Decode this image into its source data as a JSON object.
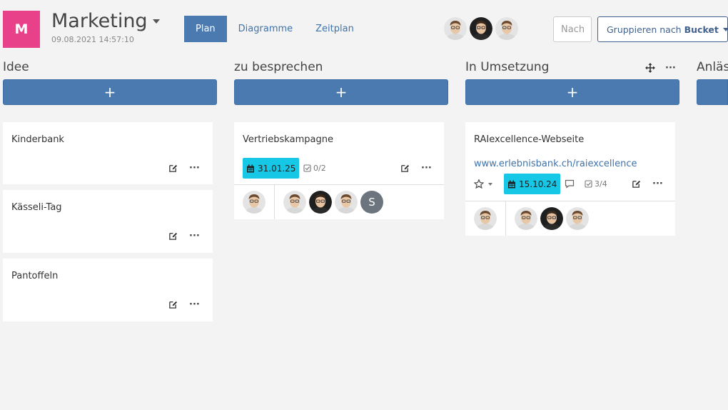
{
  "header": {
    "logo_letter": "M",
    "title": "Marketing",
    "subtitle": "09.08.2021 14:57:10",
    "tabs": [
      {
        "label": "Plan"
      },
      {
        "label": "Diagramme"
      },
      {
        "label": "Zeitplan"
      }
    ],
    "search_placeholder": "Nach",
    "group_label": "Gruppieren nach",
    "group_value": "Bucket"
  },
  "colors": {
    "accent": "#4a7ab0",
    "logo": "#e8418a",
    "date_badge": "#16c7e6"
  },
  "columns": [
    {
      "title": "Idee",
      "add_label": "+",
      "cards": [
        {
          "title": "Kinderbank"
        },
        {
          "title": "Kässeli-Tag"
        },
        {
          "title": "Pantoffeln"
        }
      ]
    },
    {
      "title": "zu besprechen",
      "add_label": "+",
      "cards": [
        {
          "title": "Vertriebskampagne",
          "date": "31.01.25",
          "checklist": "0/2",
          "assignee_letter": "S"
        }
      ]
    },
    {
      "title": "In Umsetzung",
      "add_label": "+",
      "cards": [
        {
          "title": "RAIexcellence-Webseite",
          "link": "www.erlebnisbank.ch/raiexcellence",
          "date": "15.10.24",
          "checklist": "3/4"
        }
      ]
    },
    {
      "title": "Anläss",
      "add_label": "+"
    }
  ]
}
